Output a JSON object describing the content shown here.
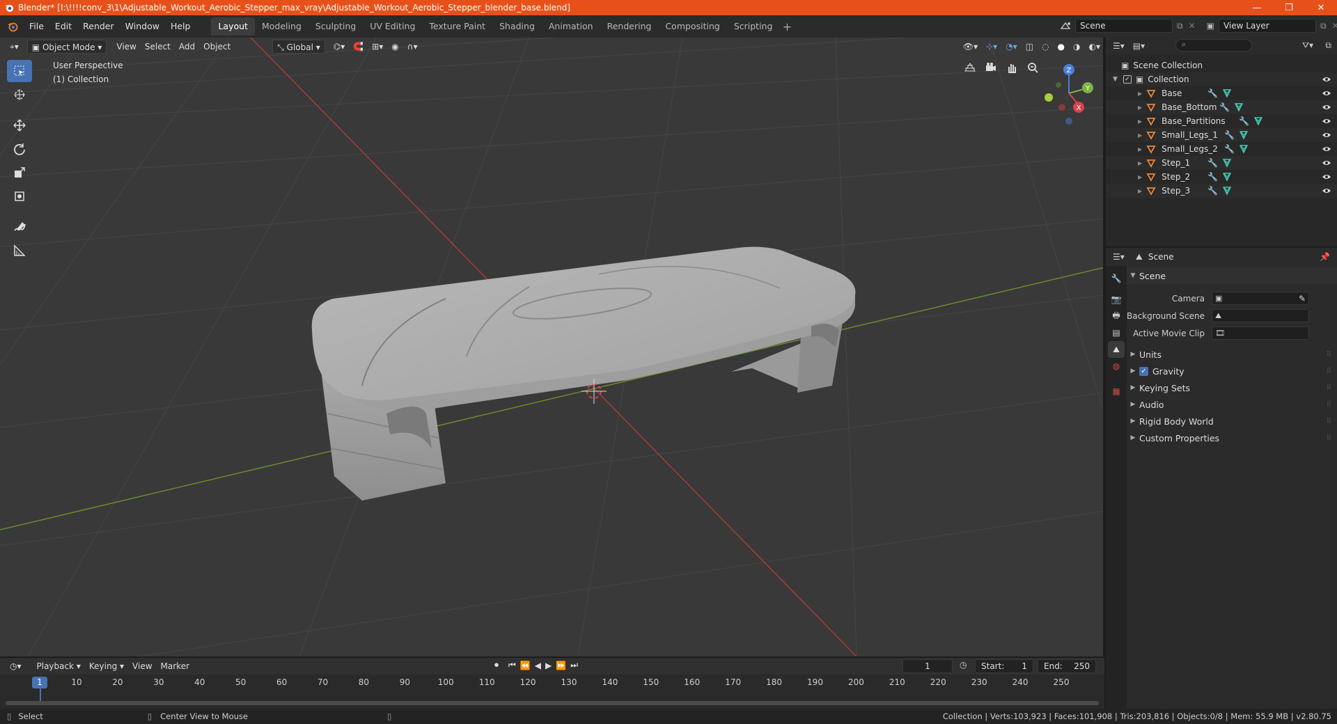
{
  "window": {
    "title": "Blender* [I:\\!!!!conv_3\\1\\Adjustable_Workout_Aerobic_Stepper_max_vray\\Adjustable_Workout_Aerobic_Stepper_blender_base.blend]",
    "minimize": "—",
    "maximize": "❐",
    "close": "✕"
  },
  "menu": [
    "File",
    "Edit",
    "Render",
    "Window",
    "Help"
  ],
  "workspaces": [
    "Layout",
    "Modeling",
    "Sculpting",
    "UV Editing",
    "Texture Paint",
    "Shading",
    "Animation",
    "Rendering",
    "Compositing",
    "Scripting"
  ],
  "active_workspace": "Layout",
  "scene_name": "Scene",
  "view_layer": "View Layer",
  "viewport": {
    "mode": "Object Mode",
    "menus": [
      "View",
      "Select",
      "Add",
      "Object"
    ],
    "orientation": "Global",
    "overlay_text_1": "User Perspective",
    "overlay_text_2": "(1) Collection",
    "gizmo_axes": {
      "z": "Z",
      "y": "Y",
      "x": "X"
    }
  },
  "outliner": {
    "root": "Scene Collection",
    "collection": "Collection",
    "objects": [
      "Base",
      "Base_Bottom",
      "Base_Partitions",
      "Small_Legs_1",
      "Small_Legs_2",
      "Step_1",
      "Step_2",
      "Step_3"
    ]
  },
  "properties": {
    "context": "Scene",
    "panel": "Scene",
    "fields": [
      {
        "label": "Camera",
        "value": ""
      },
      {
        "label": "Background Scene",
        "value": ""
      },
      {
        "label": "Active Movie Clip",
        "value": ""
      }
    ],
    "subpanels": [
      "Units",
      "Gravity",
      "Keying Sets",
      "Audio",
      "Rigid Body World",
      "Custom Properties"
    ],
    "gravity_checked": true
  },
  "timeline": {
    "menus": [
      "Playback",
      "Keying",
      "View",
      "Marker"
    ],
    "current_frame": "1",
    "start_label": "Start:",
    "start": "1",
    "end_label": "End:",
    "end": "250",
    "ruler": [
      "1",
      "10",
      "20",
      "30",
      "40",
      "50",
      "60",
      "70",
      "80",
      "90",
      "100",
      "110",
      "120",
      "130",
      "140",
      "150",
      "160",
      "170",
      "180",
      "190",
      "200",
      "210",
      "220",
      "230",
      "240",
      "250"
    ]
  },
  "statusbar": {
    "left_action": "Select",
    "mid_action": "Center View to Mouse",
    "stats": "Collection | Verts:103,923 | Faces:101,908 | Tris:203,816 | Objects:0/8 | Mem: 55.9 MB | v2.80.75"
  },
  "colors": {
    "titlebar": "#e8501a",
    "accent": "#4772b3",
    "viewport_bg": "#393939",
    "object_orange": "#e8883a",
    "modifier_blue": "#6aa6e6",
    "mesh_teal": "#47c7b0"
  }
}
